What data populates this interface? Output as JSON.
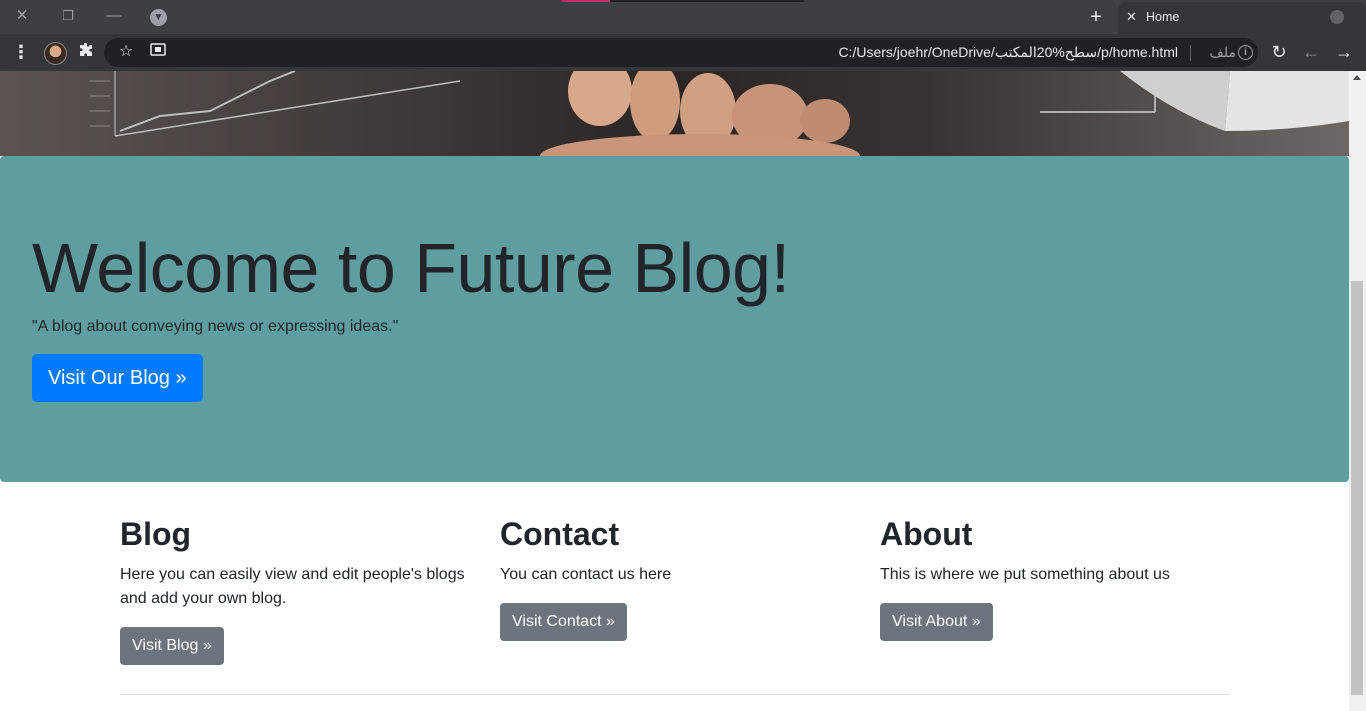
{
  "browser": {
    "tab_title": "Home",
    "url": "C:/Users/joehr/OneDrive/سطح%20المكتب/p/home.html",
    "scheme_label": "ملف",
    "accent_color": "#c0306a"
  },
  "hero": {
    "title": "Welcome to Future Blog!",
    "lead": "\"A blog about conveying news or expressing ideas.\"",
    "button_label": "Visit Our Blog »",
    "background_color": "#5f9ea0",
    "button_color": "#007bff"
  },
  "sections": [
    {
      "heading": "Blog",
      "text": "Here you can easily view and edit people's blogs and add your own blog.",
      "button_label": "Visit Blog »"
    },
    {
      "heading": "Contact",
      "text": "You can contact us here",
      "button_label": "Visit Contact »"
    },
    {
      "heading": "About",
      "text": "This is where we put something about us",
      "button_label": "Visit About »"
    }
  ],
  "icons": {
    "close": "close-icon",
    "restore": "restore-icon",
    "minimize": "minimize-icon",
    "tab_search": "tab-search-icon",
    "new_tab": "plus-icon",
    "tab_close": "close-icon",
    "menu": "kebab-menu-icon",
    "extensions": "puzzle-icon",
    "bookmark": "star-icon",
    "cast": "cast-icon",
    "info": "info-icon",
    "reload": "reload-icon",
    "back": "back-arrow-icon",
    "forward": "forward-arrow-icon"
  }
}
